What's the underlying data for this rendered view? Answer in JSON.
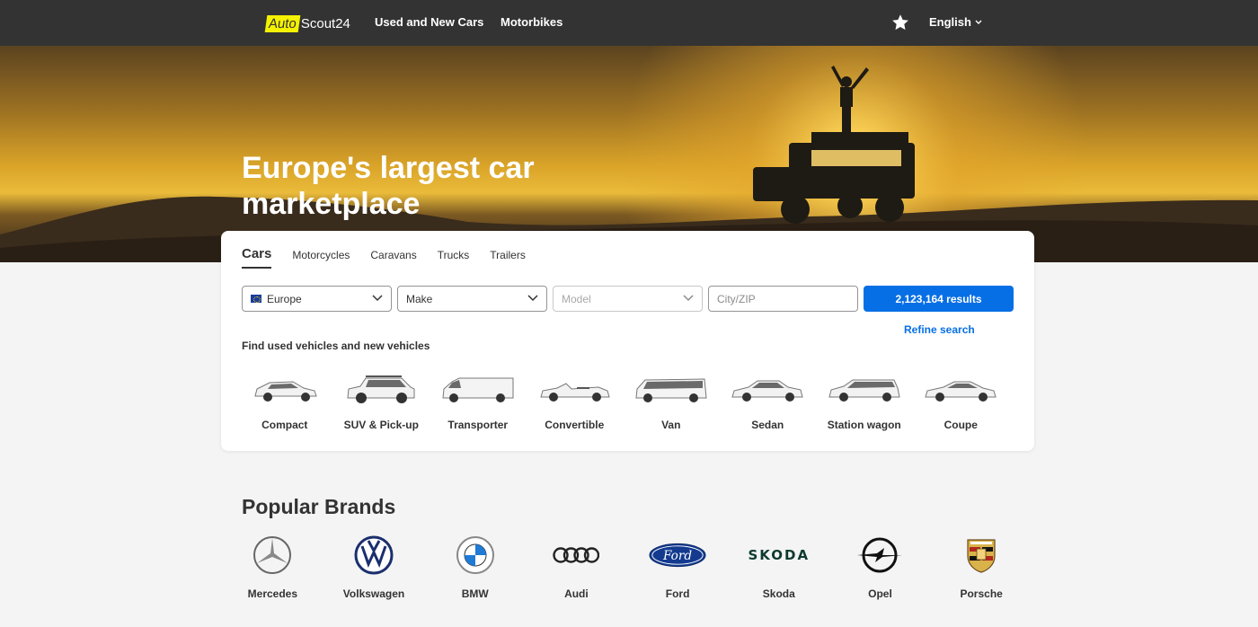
{
  "header": {
    "logo_auto": "Auto",
    "logo_scout": "Scout24",
    "nav": [
      "Used and New Cars",
      "Motorbikes"
    ],
    "language": "English",
    "bg_color": "#333333",
    "logo_accent": "#f5f200"
  },
  "hero": {
    "title": "Europe's largest car marketplace"
  },
  "search": {
    "tabs": [
      "Cars",
      "Motorcycles",
      "Caravans",
      "Trucks",
      "Trailers"
    ],
    "active_tab": "Cars",
    "country": "Europe",
    "make": "Make",
    "model": "Model",
    "city_placeholder": "City/ZIP",
    "results_button": "2,123,164 results",
    "refine": "Refine search",
    "find_text": "Find used vehicles and new vehicles",
    "button_color": "#076fe5"
  },
  "body_types": [
    {
      "label": "Compact",
      "icon": "compact-car-icon"
    },
    {
      "label": "SUV & Pick-up",
      "icon": "suv-icon"
    },
    {
      "label": "Transporter",
      "icon": "transporter-icon"
    },
    {
      "label": "Convertible",
      "icon": "convertible-icon"
    },
    {
      "label": "Van",
      "icon": "van-icon"
    },
    {
      "label": "Sedan",
      "icon": "sedan-icon"
    },
    {
      "label": "Station wagon",
      "icon": "station-wagon-icon"
    },
    {
      "label": "Coupe",
      "icon": "coupe-icon"
    }
  ],
  "brands": {
    "title": "Popular Brands",
    "items": [
      {
        "label": "Mercedes",
        "icon": "mercedes-logo"
      },
      {
        "label": "Volkswagen",
        "icon": "volkswagen-logo"
      },
      {
        "label": "BMW",
        "icon": "bmw-logo"
      },
      {
        "label": "Audi",
        "icon": "audi-logo"
      },
      {
        "label": "Ford",
        "icon": "ford-logo"
      },
      {
        "label": "Skoda",
        "icon": "skoda-logo",
        "wordmark": "SKODA"
      },
      {
        "label": "Opel",
        "icon": "opel-logo"
      },
      {
        "label": "Porsche",
        "icon": "porsche-logo"
      }
    ]
  }
}
